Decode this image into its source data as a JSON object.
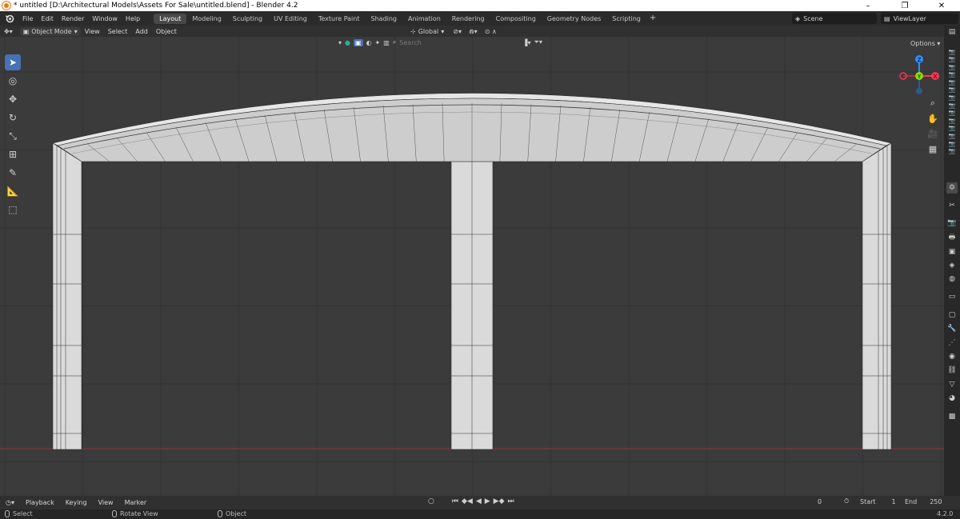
{
  "window": {
    "title": "* untitled [D:\\Architectural Models\\Assets For Sale\\untitled.blend] - Blender 4.2",
    "minimize": "–",
    "maximize": "❐",
    "close": "✕"
  },
  "menu": {
    "items": [
      "File",
      "Edit",
      "Render",
      "Window",
      "Help"
    ]
  },
  "workspaces": {
    "tabs": [
      "Layout",
      "Modeling",
      "Sculpting",
      "UV Editing",
      "Texture Paint",
      "Shading",
      "Animation",
      "Rendering",
      "Compositing",
      "Geometry Nodes",
      "Scripting"
    ],
    "active": "Layout",
    "add": "+"
  },
  "scene": {
    "label": "Scene"
  },
  "view_layer": {
    "label": "ViewLayer"
  },
  "viewport_header": {
    "mode": "Object Mode",
    "items": [
      "View",
      "Select",
      "Add",
      "Object"
    ],
    "transform_orientation": "Global",
    "options": "Options",
    "search_placeholder": "Search"
  },
  "timeline": {
    "items": [
      "Playback",
      "Keying",
      "View",
      "Marker"
    ],
    "current_frame": "0",
    "start_label": "Start",
    "start_value": "1",
    "end_label": "End",
    "end_value": "250"
  },
  "statusbar": {
    "select": "Select",
    "rotate": "Rotate View",
    "object": "Object",
    "version": "4.2.0"
  },
  "gizmo": {
    "x": "X",
    "y": "Y",
    "z": "Z"
  },
  "colors": {
    "accent": "#4772b3",
    "viewport_bg": "#3b3b3b",
    "axis_x": "#ff3352",
    "axis_y": "#8bdc00",
    "axis_z": "#2890ff",
    "mesh": "#c9c9c9"
  }
}
